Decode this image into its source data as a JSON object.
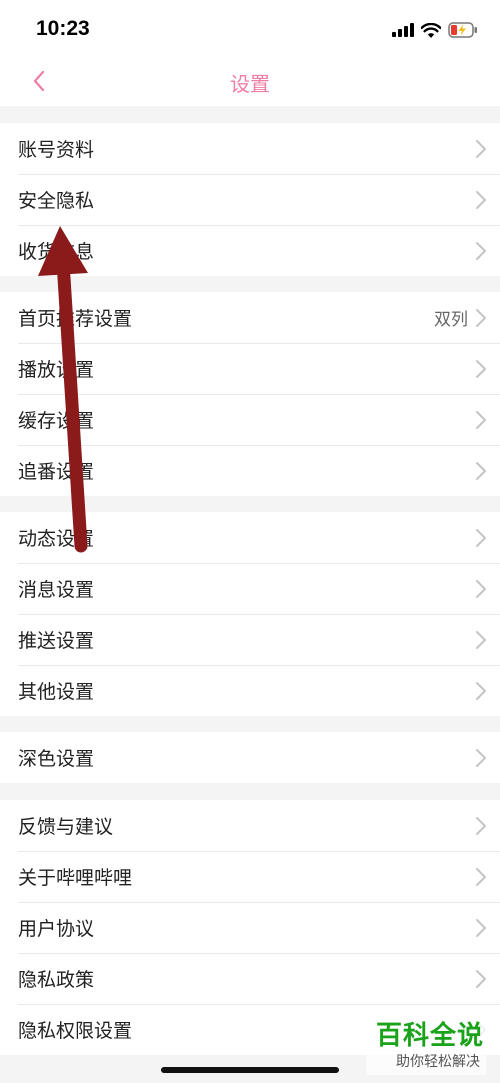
{
  "status_bar": {
    "time": "10:23"
  },
  "nav": {
    "title": "设置"
  },
  "groups": [
    {
      "items": [
        {
          "label": "账号资料"
        },
        {
          "label": "安全隐私"
        },
        {
          "label": "收货信息"
        }
      ]
    },
    {
      "items": [
        {
          "label": "首页推荐设置",
          "value": "双列"
        },
        {
          "label": "播放设置"
        },
        {
          "label": "缓存设置"
        },
        {
          "label": "追番设置"
        }
      ]
    },
    {
      "items": [
        {
          "label": "动态设置"
        },
        {
          "label": "消息设置"
        },
        {
          "label": "推送设置"
        },
        {
          "label": "其他设置"
        }
      ]
    },
    {
      "items": [
        {
          "label": "深色设置"
        }
      ]
    },
    {
      "items": [
        {
          "label": "反馈与建议"
        },
        {
          "label": "关于哔哩哔哩"
        },
        {
          "label": "用户协议"
        },
        {
          "label": "隐私政策"
        },
        {
          "label": "隐私权限设置"
        }
      ]
    }
  ],
  "watermark": {
    "title": "百科全说",
    "subtitle": "助你轻松解决"
  },
  "colors": {
    "accent_pink": "#f07da3",
    "annotation_arrow": "#8b1a1a",
    "watermark_green": "#1aa31a"
  },
  "icons": [
    "back-chevron-icon",
    "signal-icon",
    "wifi-icon",
    "battery-charging-icon",
    "chevron-right-icon"
  ]
}
